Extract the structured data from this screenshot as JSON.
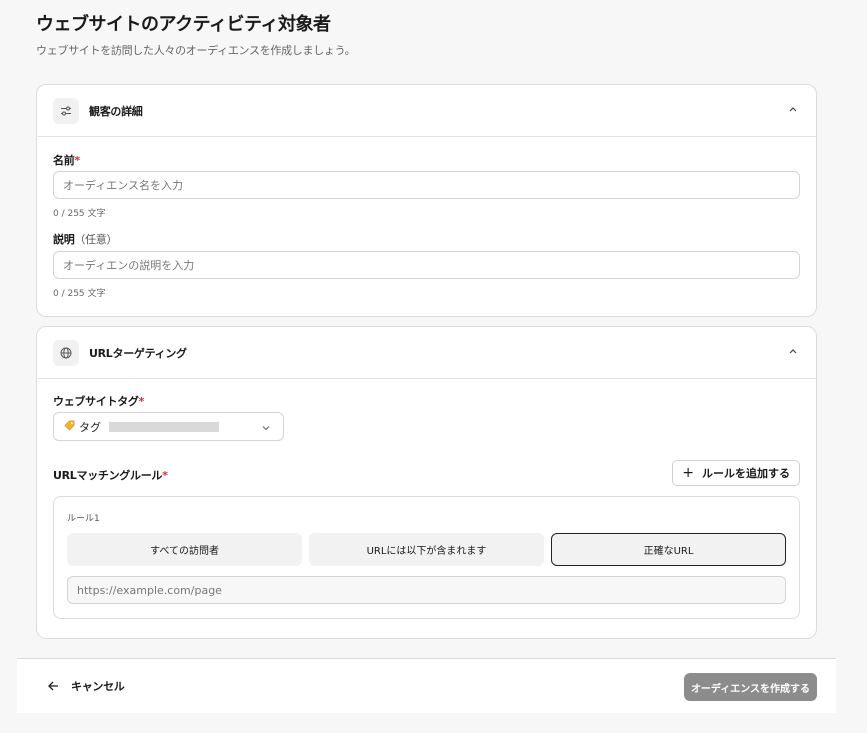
{
  "header": {
    "title": "ウェブサイトのアクティビティ対象者",
    "subtitle": "ウェブサイトを訪問した人々のオーディエンスを作成しましょう。"
  },
  "audience_details": {
    "title": "観客の詳細",
    "name_label": "名前",
    "name_required": "*",
    "name_placeholder": "オーディエンス名を入力",
    "name_value": "",
    "name_counter": "0 / 255 文字",
    "description_label": "説明",
    "description_optional": "（任意）",
    "description_placeholder": "オーディエンの説明を入力",
    "description_value": "",
    "description_counter": "0 / 255 文字"
  },
  "url_targeting": {
    "title": "URLターゲティング",
    "website_tag_label": "ウェブサイトタグ",
    "website_tag_required": "*",
    "selected_tag_label": "タグ",
    "matching_rules_label": "URLマッチングルール",
    "matching_rules_required": "*",
    "add_rule_label": "ルールを追加する",
    "rules": [
      {
        "title": "ルール1",
        "options": [
          "すべての訪問者",
          "URLには以下が含まれます",
          "正確なURL"
        ],
        "selected": "正確なURL",
        "url_placeholder": "https://example.com/page",
        "url_value": ""
      }
    ]
  },
  "footer": {
    "cancel_label": "キャンセル",
    "create_label": "オーディエンスを作成する"
  },
  "colors": {
    "required": "#d32f2f",
    "primary_disabled": "#8c8c8c",
    "background": "#f7f7f7"
  },
  "icons": {
    "audience_details": "sliders-icon",
    "url_targeting": "globe-icon",
    "tag": "tag-icon"
  }
}
